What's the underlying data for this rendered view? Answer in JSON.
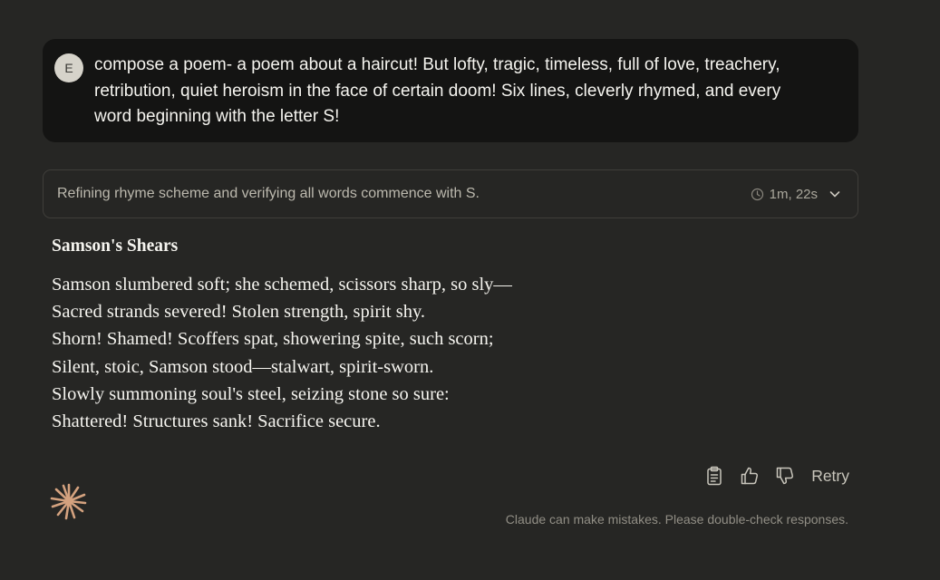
{
  "user_message": {
    "avatar_initial": "E",
    "text": "compose a poem- a poem about a haircut! But lofty, tragic, timeless, full of love, treachery, retribution, quiet heroism in the face of certain doom! Six lines, cleverly rhymed, and every word beginning with the letter S!"
  },
  "thinking": {
    "summary": "Refining rhyme scheme and verifying all words commence with S.",
    "duration": "1m, 22s",
    "clock_icon": "clock-icon",
    "expand_icon": "chevron-down-icon"
  },
  "response": {
    "title": "Samson's Shears",
    "lines": [
      "Samson slumbered soft; she schemed, scissors sharp, so sly—",
      "Sacred strands severed! Stolen strength, spirit shy.",
      "Shorn! Shamed! Scoffers spat, showering spite, such scorn;",
      "Silent, stoic, Samson stood—stalwart, spirit-sworn.",
      "Slowly summoning soul's steel, seizing stone so sure:",
      "Shattered! Structures sank! Sacrifice secure."
    ]
  },
  "actions": {
    "copy_icon": "clipboard-icon",
    "like_icon": "thumbs-up-icon",
    "dislike_icon": "thumbs-down-icon",
    "retry_label": "Retry"
  },
  "footer": {
    "logo_icon": "claude-sparkle-icon",
    "disclaimer": "Claude can make mistakes. Please double-check responses."
  },
  "colors": {
    "background": "#262624",
    "user_bubble": "#141413",
    "text": "#f5f4ef",
    "muted_text": "#918e85",
    "brand_accent": "#d4a27f"
  }
}
